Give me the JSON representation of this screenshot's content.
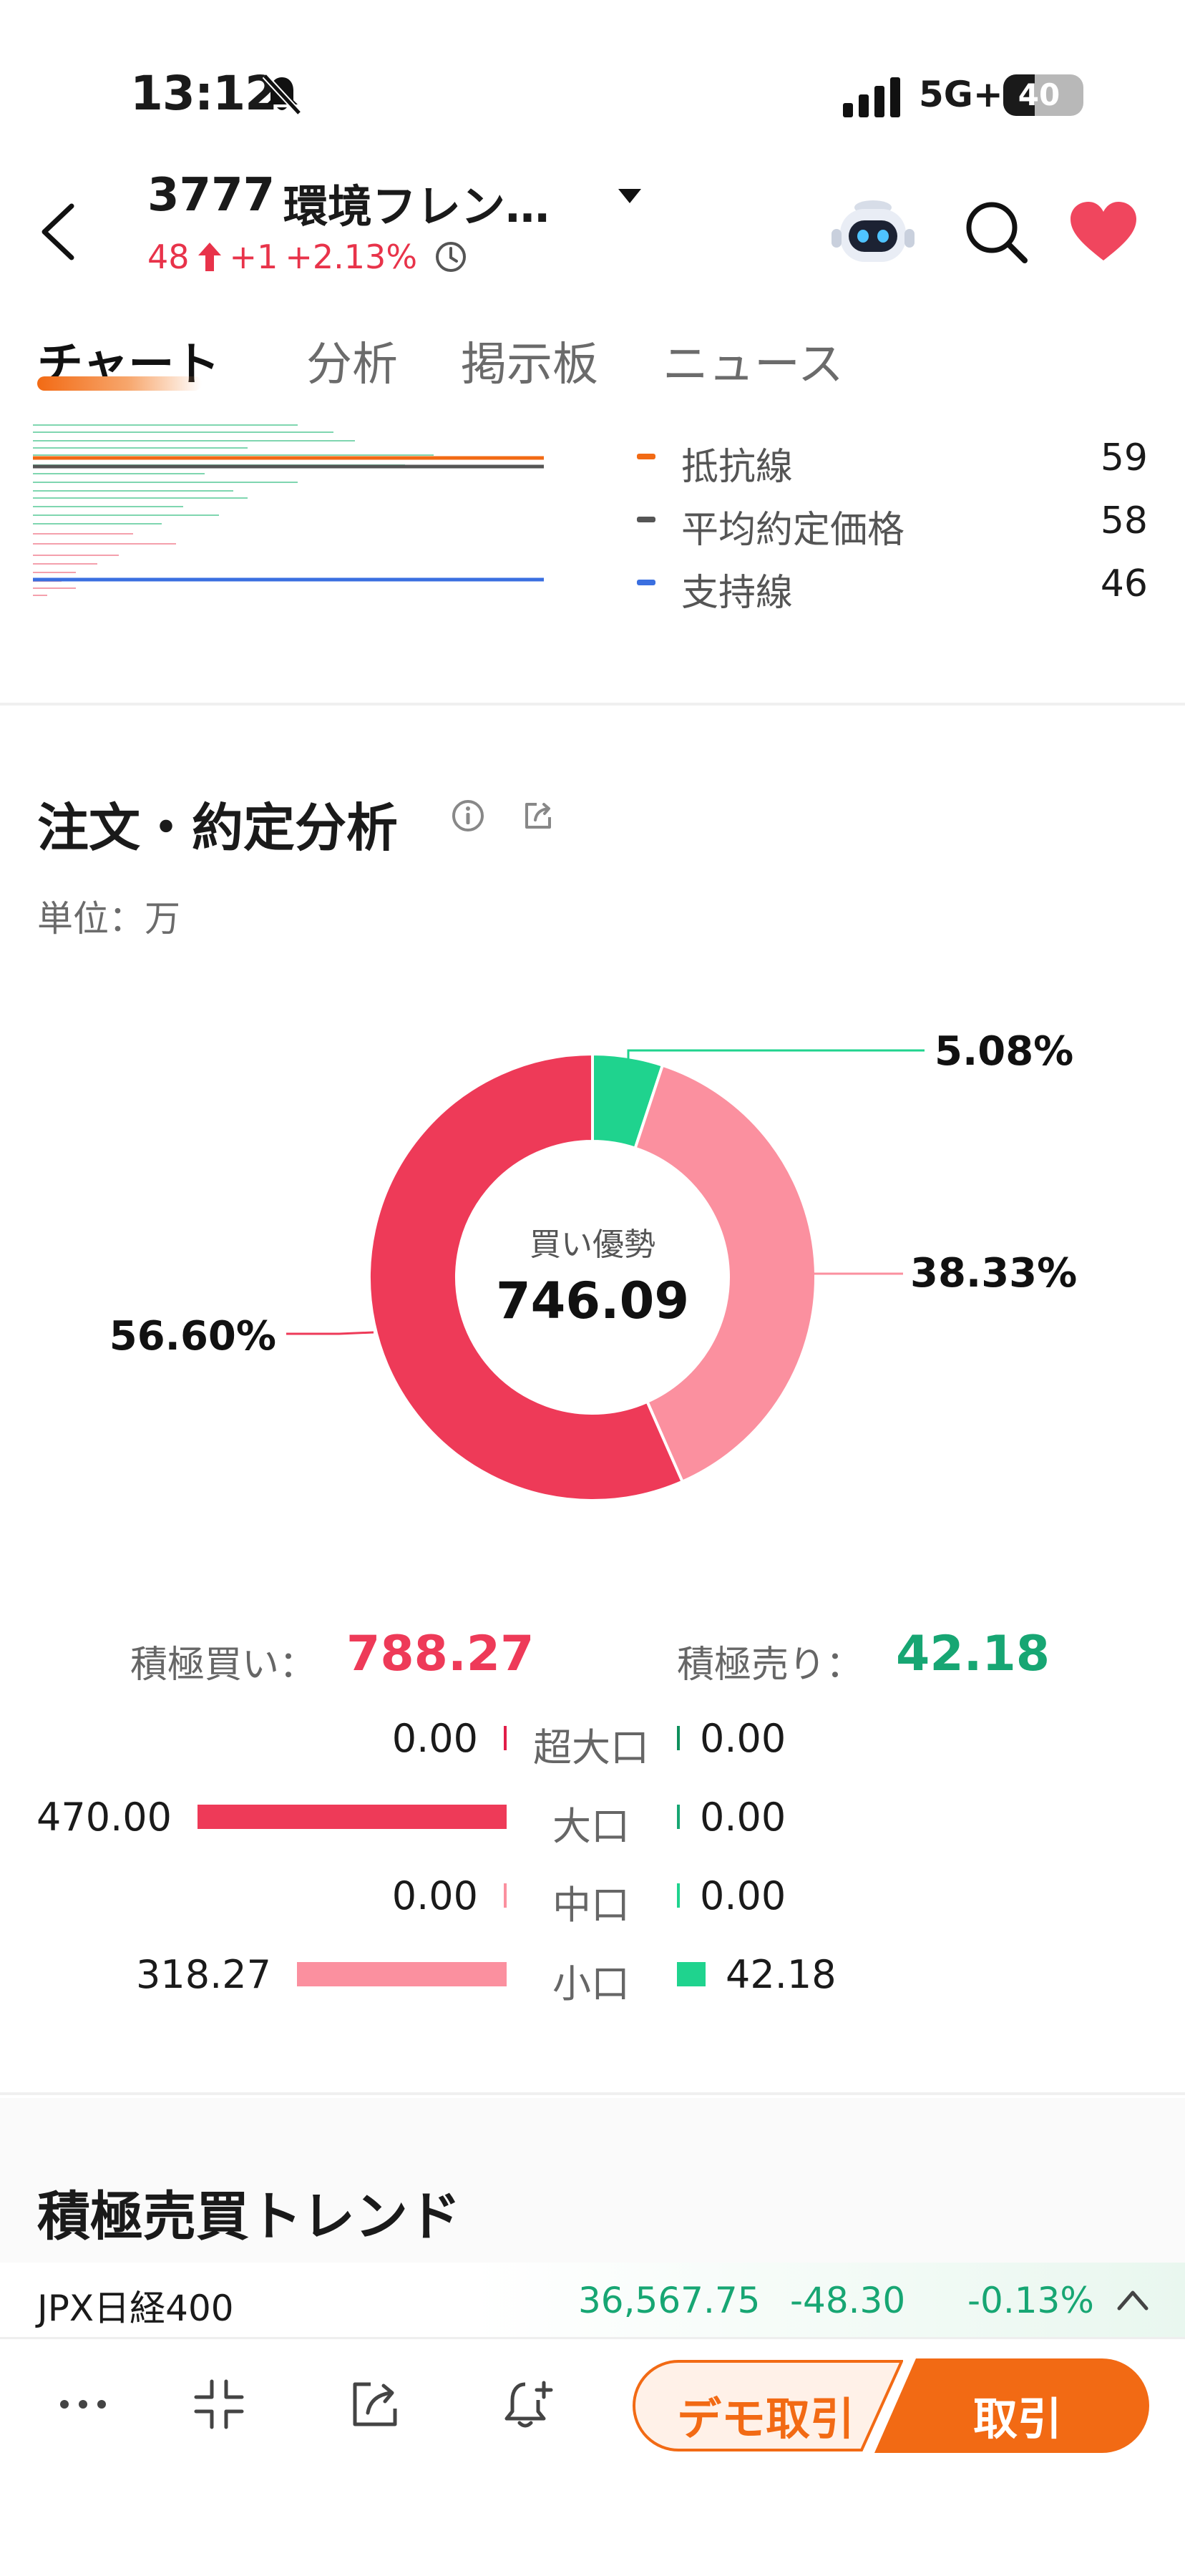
{
  "status_bar": {
    "time": "13:12",
    "network": "5G+",
    "battery": "40"
  },
  "header": {
    "code": "3777",
    "name": "環境フレン…",
    "price": "48",
    "change": "+1",
    "change_pct": "+2.13%"
  },
  "tabs": [
    {
      "label": "チャート",
      "active": true
    },
    {
      "label": "分析",
      "active": false
    },
    {
      "label": "掲示板",
      "active": false
    },
    {
      "label": "ニュース",
      "active": false
    }
  ],
  "price_levels": [
    {
      "label": "抵抗線",
      "value": "59",
      "color": "#f26a14"
    },
    {
      "label": "平均約定価格",
      "value": "58",
      "color": "#555555"
    },
    {
      "label": "支持線",
      "value": "46",
      "color": "#3a6fe0"
    }
  ],
  "order_analysis": {
    "title": "注文・約定分析",
    "unit": "単位：万",
    "center_label": "買い優勢",
    "center_value": "746.09",
    "slices": [
      {
        "label": "5.08%",
        "value": 5.08,
        "color": "#1fd38e"
      },
      {
        "label": "38.33%",
        "value": 38.33,
        "color": "#fb909f"
      },
      {
        "label": "56.60%",
        "value": 56.6,
        "color": "#ee3a58"
      }
    ],
    "buy_label": "積極買い：",
    "buy_value": "788.27",
    "sell_label": "積極売り：",
    "sell_value": "42.18",
    "buy_color": "#ee3a58",
    "sell_color": "#17a673",
    "rows": [
      {
        "label": "超大口",
        "buy": "0.00",
        "sell": "0.00",
        "buy_num": 0,
        "sell_num": 0,
        "buy_color": "#e11d48",
        "sell_color": "#0e8f5c"
      },
      {
        "label": "大口",
        "buy": "470.00",
        "sell": "0.00",
        "buy_num": 470.0,
        "sell_num": 0,
        "buy_color": "#ee3a58",
        "sell_color": "#17a673"
      },
      {
        "label": "中口",
        "buy": "0.00",
        "sell": "0.00",
        "buy_num": 0,
        "sell_num": 0,
        "buy_color": "#fb909f",
        "sell_color": "#1fd38e"
      },
      {
        "label": "小口",
        "buy": "318.27",
        "sell": "42.18",
        "buy_num": 318.27,
        "sell_num": 42.18,
        "buy_color": "#fb909f",
        "sell_color": "#1fd38e"
      }
    ]
  },
  "trend": {
    "title": "積極売買トレンド"
  },
  "index_strip": {
    "name": "JPX日経400",
    "value": "36,567.75",
    "change": "-48.30",
    "change_pct": "-0.13%"
  },
  "bottom_bar": {
    "demo_label": "デモ取引",
    "trade_label": "取引"
  },
  "icons": [
    "bell-muted-icon",
    "signal-icon",
    "back-icon",
    "caret-down-icon",
    "clock-icon",
    "robot-icon",
    "search-icon",
    "heart-icon",
    "info-icon",
    "share-icon",
    "chevron-up-icon",
    "more-icon",
    "compress-icon",
    "export-icon",
    "alert-add-icon"
  ]
}
